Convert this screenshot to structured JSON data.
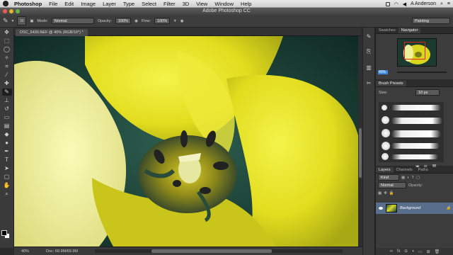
{
  "menubar": {
    "app_name": "Photoshop",
    "items": [
      "File",
      "Edit",
      "Image",
      "Layer",
      "Type",
      "Select",
      "Filter",
      "3D",
      "View",
      "Window",
      "Help"
    ],
    "user": "A Anderson"
  },
  "window": {
    "title": "Adobe Photoshop CC"
  },
  "options": {
    "brush_size": "30",
    "mode_label": "Mode:",
    "mode_value": "Normal",
    "opacity_label": "Opacity:",
    "opacity_value": "100%",
    "flow_label": "Flow:",
    "flow_value": "100%",
    "workspace": "Painting"
  },
  "document": {
    "tab_label": "DSC_6430.NEF @ 40% (RGB/16*) *",
    "zoom": "40%",
    "doc_size": "Doc: 69.9M/69.9M"
  },
  "navigator": {
    "tabs": [
      "Swatches",
      "Navigator"
    ],
    "zoom": "40%"
  },
  "brush_presets": {
    "title": "Brush Presets",
    "size_label": "Size:",
    "size_value": "10 px"
  },
  "layers": {
    "tabs": [
      "Layers",
      "Channels",
      "Paths"
    ],
    "filter_label": "Kind",
    "blend_mode": "Normal",
    "opacity_label": "Opacity:",
    "layer_name": "Background"
  },
  "colors": {
    "accent": "#3d8ae0",
    "nav_box": "#e0241b",
    "selected_layer": "#596e8a"
  }
}
